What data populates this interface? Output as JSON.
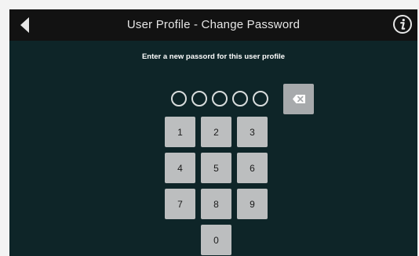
{
  "header": {
    "title": "User Profile - Change Password",
    "back_icon": "back-arrow-icon",
    "info_icon": "info-icon"
  },
  "prompt": "Enter a new passord for this user profile",
  "pin": {
    "length": 5,
    "filled": 0
  },
  "keypad": {
    "keys": [
      "1",
      "2",
      "3",
      "4",
      "5",
      "6",
      "7",
      "8",
      "9",
      "0"
    ],
    "backspace_icon": "backspace-icon"
  },
  "colors": {
    "background": "#0e2528",
    "titlebar": "#121212",
    "key": "#bcbebf",
    "backspace_key": "#a7aaac"
  }
}
